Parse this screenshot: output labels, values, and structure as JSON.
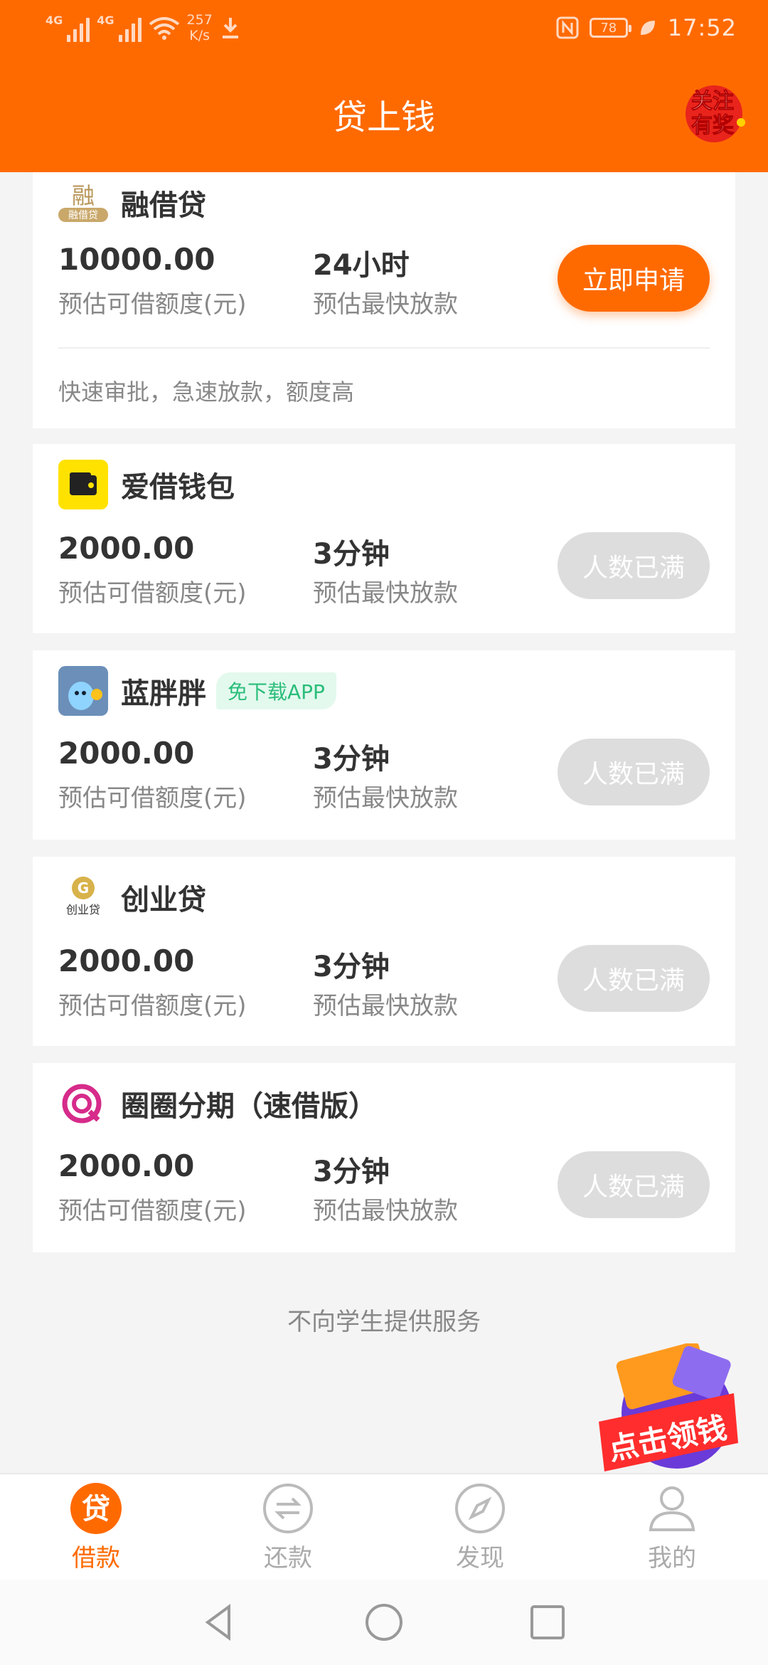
{
  "status_bar": {
    "network_1": "4G",
    "network_2": "4G",
    "speed_value": "257",
    "speed_unit": "K/s",
    "battery": "78",
    "time": "17:52"
  },
  "header": {
    "title": "贷上钱",
    "badge_text": "关注有奖"
  },
  "loans": [
    {
      "name": "融借贷",
      "logo_text": "融借贷",
      "amount": "10000.00",
      "amount_label": "预估可借额度(元)",
      "speed": "24小时",
      "speed_label": "预估最快放款",
      "button": "立即申请",
      "description": "快速审批，急速放款，额度高"
    },
    {
      "name": "爱借钱包",
      "amount": "2000.00",
      "amount_label": "预估可借额度(元)",
      "speed": "3分钟",
      "speed_label": "预估最快放款",
      "button": "人数已满"
    },
    {
      "name": "蓝胖胖",
      "tag": "免下载APP",
      "amount": "2000.00",
      "amount_label": "预估可借额度(元)",
      "speed": "3分钟",
      "speed_label": "预估最快放款",
      "button": "人数已满"
    },
    {
      "name": "创业贷",
      "logo_text": "创业贷",
      "amount": "2000.00",
      "amount_label": "预估可借额度(元)",
      "speed": "3分钟",
      "speed_label": "预估最快放款",
      "button": "人数已满"
    },
    {
      "name": "圈圈分期（速借版）",
      "amount": "2000.00",
      "amount_label": "预估可借额度(元)",
      "speed": "3分钟",
      "speed_label": "预估最快放款",
      "button": "人数已满"
    }
  ],
  "notice": "不向学生提供服务",
  "promo": {
    "text": "点击领钱"
  },
  "tabs": [
    {
      "label": "借款",
      "icon": "loan-icon",
      "icon_char": "贷",
      "active": true
    },
    {
      "label": "还款",
      "icon": "repay-icon",
      "active": false
    },
    {
      "label": "发现",
      "icon": "compass-icon",
      "active": false
    },
    {
      "label": "我的",
      "icon": "user-icon",
      "active": false
    }
  ],
  "colors": {
    "brand": "#ff6a00",
    "disabled_button": "#dddddd",
    "tag_bg": "#e3f9ee",
    "tag_text": "#2bbd7a"
  }
}
